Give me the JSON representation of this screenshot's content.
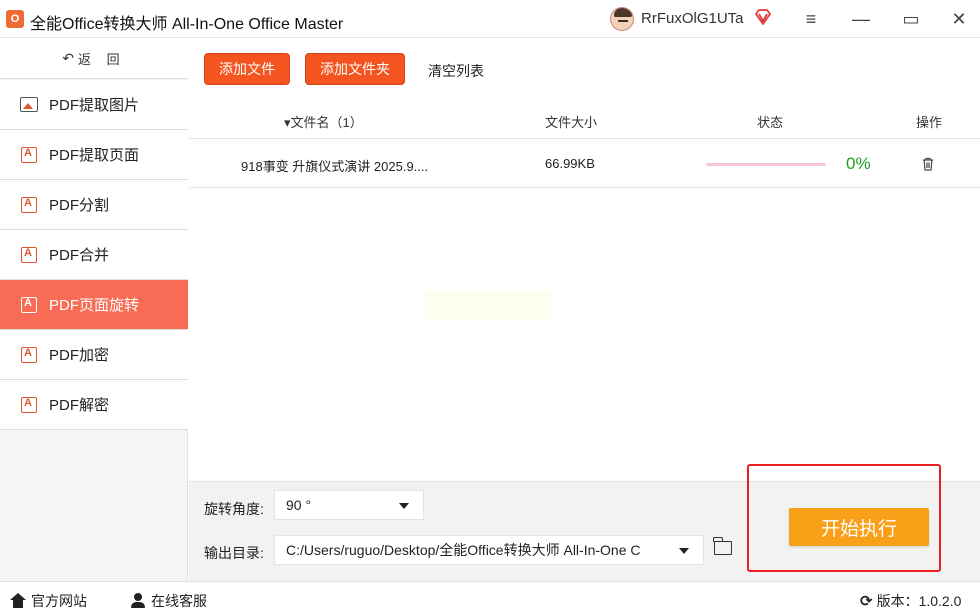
{
  "window": {
    "title": "全能Office转换大师 All-In-One Office Master",
    "logo_text": "O",
    "username": "RrFuxOlG1UTa",
    "minimize_glyph": "—",
    "maximize_glyph": "▭",
    "close_glyph": "✕",
    "menu_glyph": "≡"
  },
  "sidebar": {
    "back_label": "返 回",
    "items": [
      {
        "label": "PDF提取图片",
        "icon": "image-icon",
        "active": false
      },
      {
        "label": "PDF提取页面",
        "icon": "pdf-icon",
        "active": false
      },
      {
        "label": "PDF分割",
        "icon": "pdf-icon",
        "active": false
      },
      {
        "label": "PDF合并",
        "icon": "pdf-icon",
        "active": false
      },
      {
        "label": "PDF页面旋转",
        "icon": "pdf-icon",
        "active": true
      },
      {
        "label": "PDF加密",
        "icon": "pdf-icon",
        "active": false
      },
      {
        "label": "PDF解密",
        "icon": "pdf-icon",
        "active": false
      }
    ]
  },
  "toolbar": {
    "add_file_label": "添加文件",
    "add_folder_label": "添加文件夹",
    "clear_list_label": "清空列表"
  },
  "table": {
    "columns": {
      "name": "▾文件名（1）",
      "size": "文件大小",
      "status": "状态",
      "action": "操作"
    },
    "rows": [
      {
        "name": "918事变 升旗仪式演讲 2025.9....",
        "size": "66.99KB",
        "progress": 0,
        "progress_text": "0%"
      }
    ]
  },
  "config": {
    "angle_label": "旋转角度:",
    "angle_value": "90 °",
    "output_label": "输出目录:",
    "output_value": "C:/Users/ruguo/Desktop/全能Office转换大师 All-In-One C"
  },
  "start_button_label": "开始执行",
  "statusbar": {
    "website_label": "官方网站",
    "support_label": "在线客服",
    "version_label": "版本：1.0.2.0"
  },
  "colors": {
    "accent_orange": "#f4541f",
    "active_nav": "#f86b55",
    "start_button": "#f9a019",
    "progress_green": "#1fa01f",
    "highlight_red": "#e82020"
  }
}
